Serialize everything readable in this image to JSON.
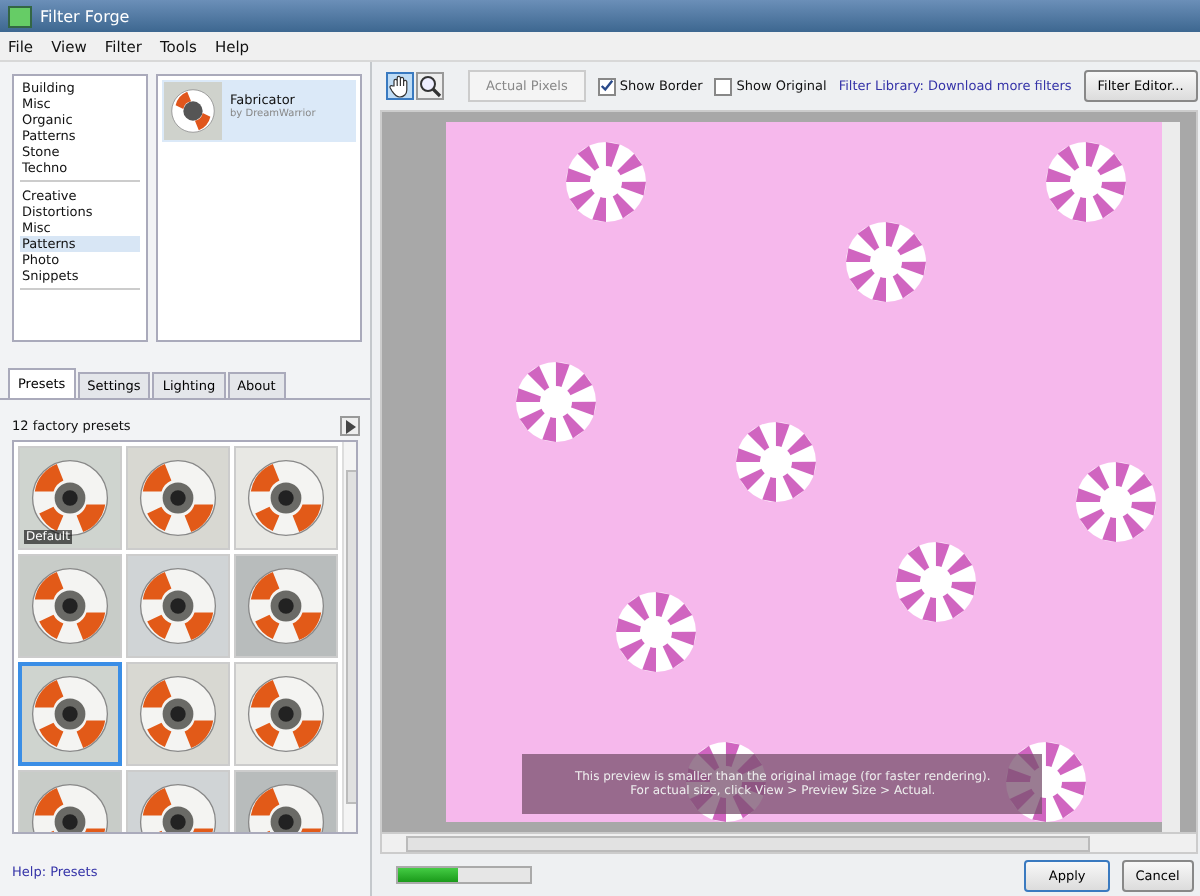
{
  "window": {
    "title": "Filter Forge"
  },
  "menu": [
    "File",
    "View",
    "Filter",
    "Tools",
    "Help"
  ],
  "category_groups": [
    [
      {
        "label": "Building",
        "selected": false
      },
      {
        "label": "Misc",
        "selected": false
      },
      {
        "label": "Organic",
        "selected": false
      },
      {
        "label": "Patterns",
        "selected": false
      },
      {
        "label": "Stone",
        "selected": false
      },
      {
        "label": "Techno",
        "selected": false
      }
    ],
    [
      {
        "label": "Creative",
        "selected": false
      },
      {
        "label": "Distortions",
        "selected": false
      },
      {
        "label": "Misc",
        "selected": false
      },
      {
        "label": "Patterns",
        "selected": true
      },
      {
        "label": "Photo",
        "selected": false
      },
      {
        "label": "Snippets",
        "selected": false
      }
    ]
  ],
  "filters": [
    {
      "name": "Fabricator",
      "author": "by DreamWarrior",
      "selected": true
    }
  ],
  "tabs": [
    {
      "label": "Presets",
      "selected": true
    },
    {
      "label": "Settings",
      "selected": false
    },
    {
      "label": "Lighting",
      "selected": false
    },
    {
      "label": "About",
      "selected": false
    }
  ],
  "presets_count": "12 factory presets",
  "presets": [
    {
      "label": "Default",
      "selected": false
    },
    {
      "selected": false
    },
    {
      "selected": false
    },
    {
      "selected": false
    },
    {
      "selected": false
    },
    {
      "selected": false
    },
    {
      "selected": true
    },
    {
      "selected": false
    },
    {
      "selected": false
    },
    {
      "selected": false
    },
    {
      "selected": false
    },
    {
      "selected": false
    }
  ],
  "help_link": "Help: Presets",
  "toolbar": {
    "actual_pixels": "Actual Pixels",
    "show_border": {
      "label": "Show Border",
      "checked": true
    },
    "show_original": {
      "label": "Show Original",
      "checked": false
    },
    "library_link": "Filter Library: Download more filters",
    "editor_button": "Filter Editor..."
  },
  "preview_notice": [
    "This preview is smaller than the original image (for faster rendering).",
    "For actual size, click View > Preview Size > Actual."
  ],
  "progress": {
    "level": 0.45
  },
  "buttons": {
    "apply": "Apply",
    "cancel": "Cancel"
  }
}
